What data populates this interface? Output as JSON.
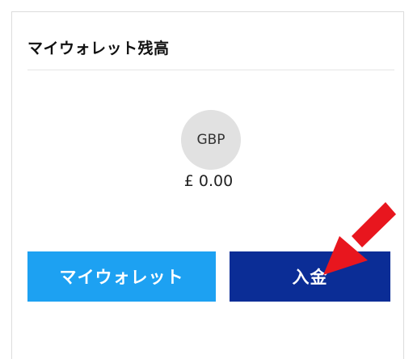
{
  "wallet_card": {
    "title": "マイウォレット残高",
    "currency_code": "GBP",
    "balance": "£ 0.00",
    "buttons": {
      "my_wallet_label": "マイウォレット",
      "deposit_label": "入金"
    }
  },
  "colors": {
    "my_wallet_button": "#1da1f2",
    "deposit_button": "#0b2d96",
    "annotation_arrow": "#e8161e"
  },
  "annotation": {
    "icon": "red-arrow-icon",
    "points_to": "deposit-button"
  }
}
